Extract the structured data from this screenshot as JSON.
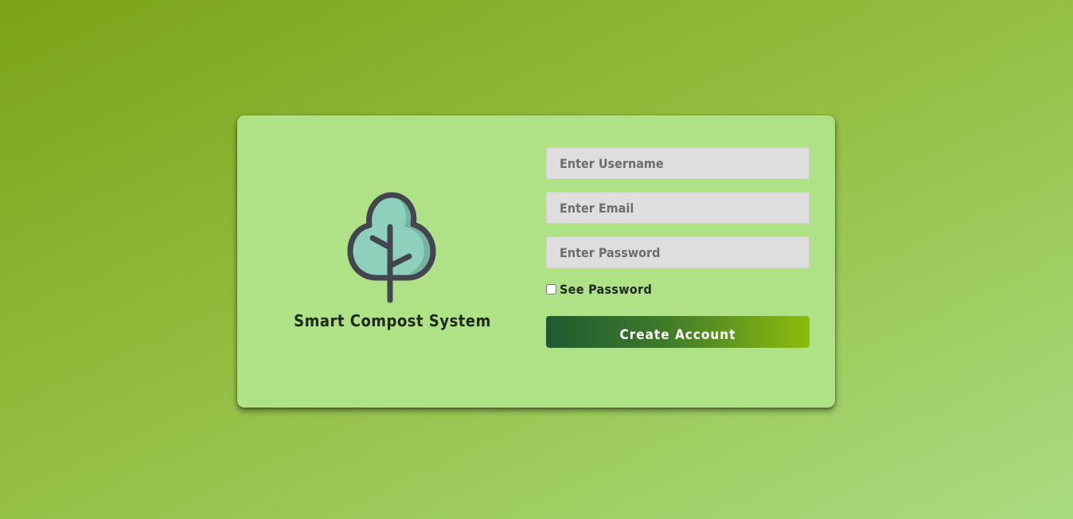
{
  "brand": {
    "title": "Smart Compost System",
    "logo_icon": "tree-icon"
  },
  "form": {
    "username": {
      "placeholder": "Enter Username",
      "value": ""
    },
    "email": {
      "placeholder": "Enter Email",
      "value": ""
    },
    "password": {
      "placeholder": "Enter Password",
      "value": ""
    },
    "see_password": {
      "label": "See Password",
      "checked": false
    },
    "submit_label": "Create Account"
  },
  "colors": {
    "card_background": "#afe187",
    "button_gradient_start": "#1f5a32",
    "button_gradient_end": "#8cbc0e",
    "input_background": "#dfdede"
  }
}
